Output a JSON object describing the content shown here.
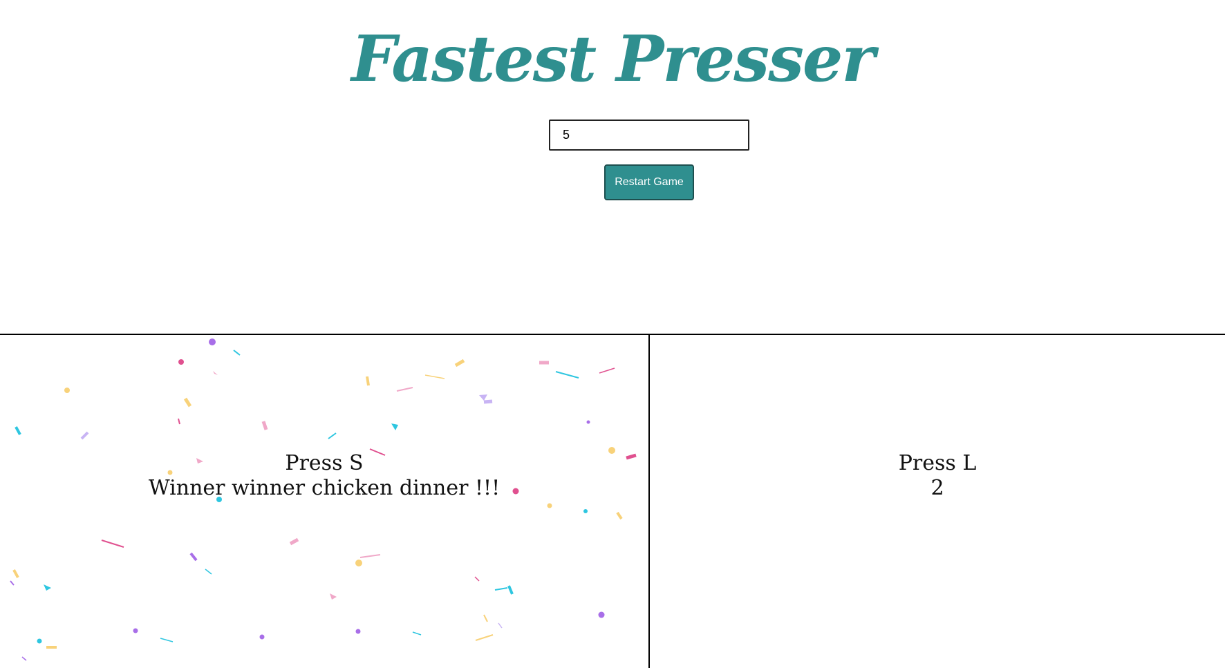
{
  "header": {
    "title": "Fastest Presser"
  },
  "controls": {
    "target_score_value": "5",
    "restart_label": "Restart Game"
  },
  "players": [
    {
      "prompt": "Press S",
      "status": "Winner winner chicken dinner !!!"
    },
    {
      "prompt": "Press L",
      "status": "2"
    }
  ],
  "colors": {
    "accent": "#2f8f8f",
    "confetti": [
      "#a86ee8",
      "#e0508f",
      "#2ec6e0",
      "#f8d27a",
      "#f0a8c8",
      "#c8b4f4"
    ]
  }
}
